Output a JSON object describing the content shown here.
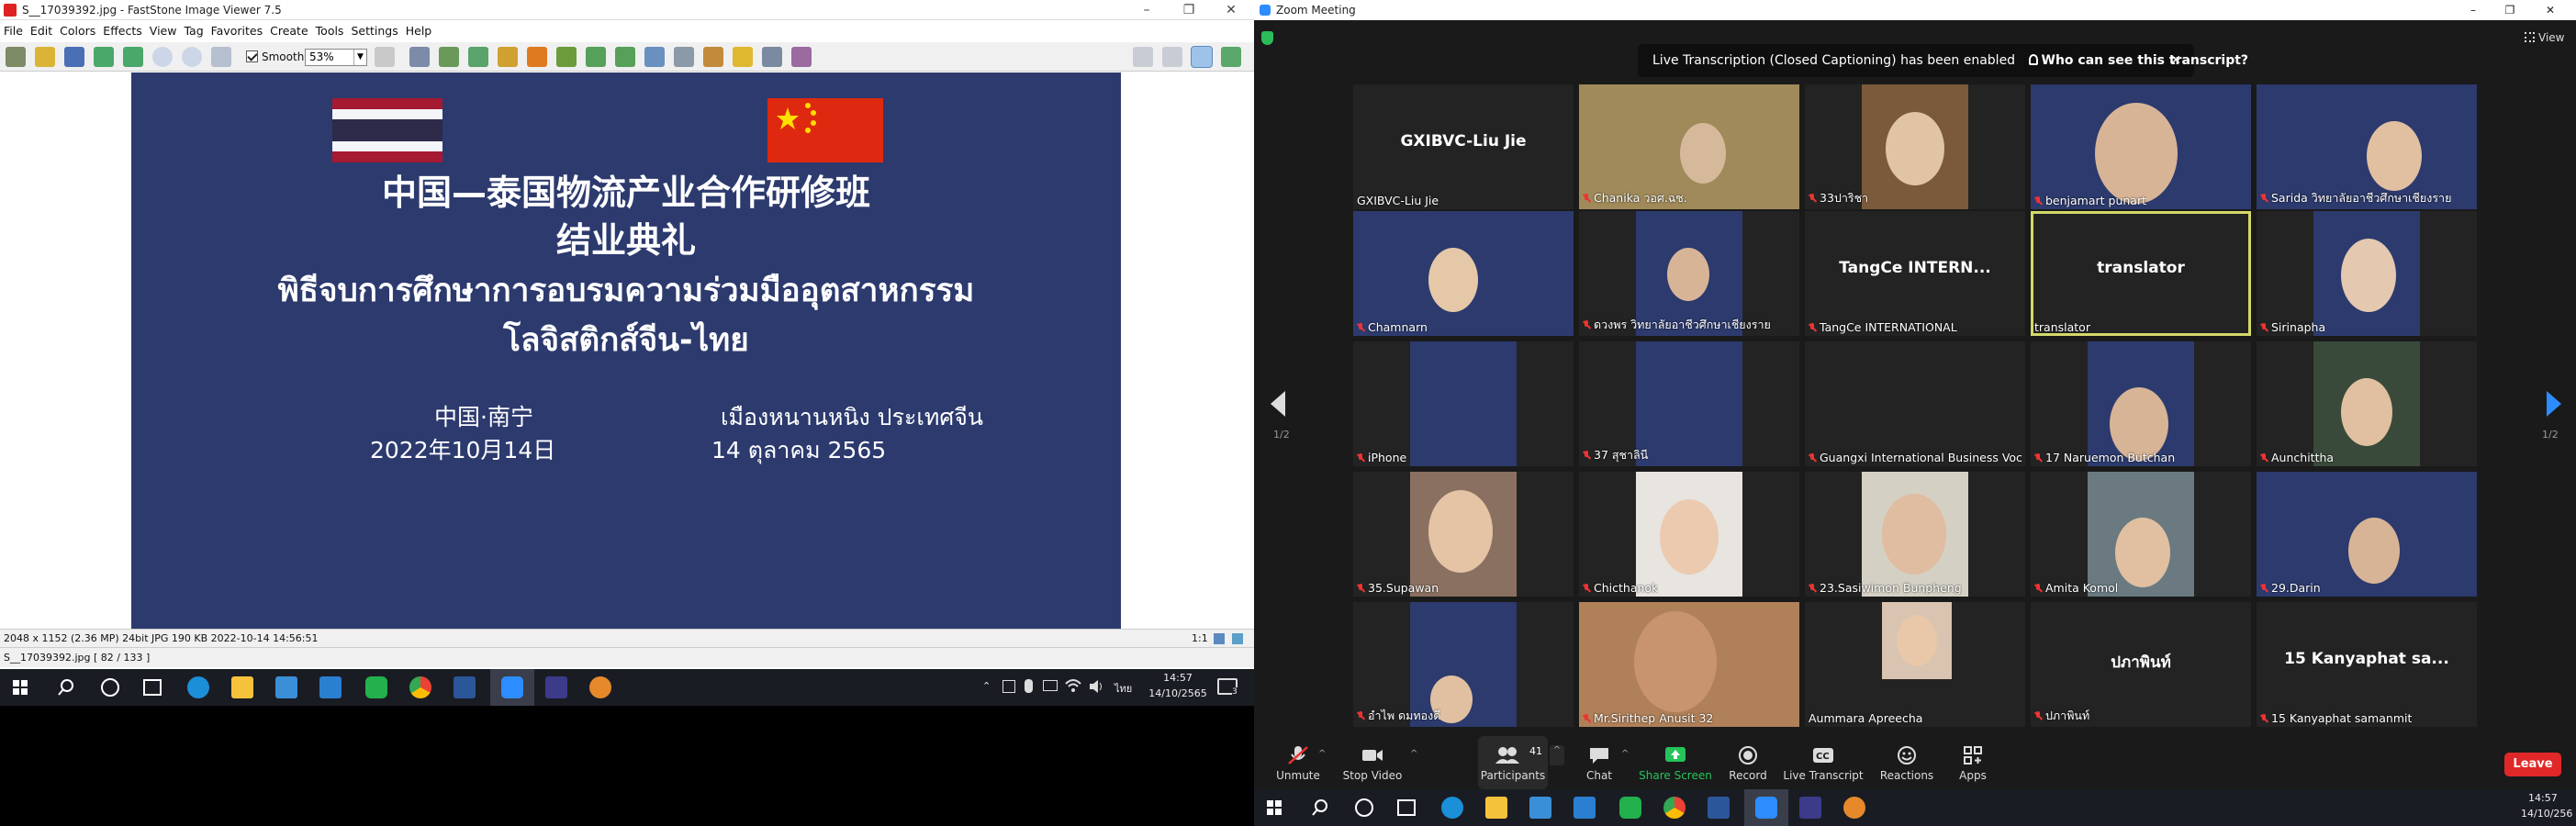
{
  "faststone": {
    "window_title": "S__17039392.jpg - FastStone Image Viewer 7.5",
    "menu": [
      "File",
      "Edit",
      "Colors",
      "Effects",
      "View",
      "Tag",
      "Favorites",
      "Create",
      "Tools",
      "Settings",
      "Help"
    ],
    "smooth_label": "Smooth",
    "zoom_value": "53%",
    "slide": {
      "title_cn_1": "中国—泰国物流产业合作研修班",
      "title_cn_2": "结业典礼",
      "title_th_1": "พิธีจบการศึกษาการอบรมความร่วมมืออุตสาหกรรม",
      "title_th_2": "โลจิสติกส์จีน-ไทย",
      "place_cn": "中国·南宁",
      "date_cn": "2022年10月14日",
      "place_th": "เมืองหนานหนิง ประเทศจีน",
      "date_th": "14 ตุลาคม 2565"
    },
    "status": "2048 x 1152 (2.36 MP)  24bit  JPG  190 KB  2022-10-14 14:56:51",
    "status_ratio": "1:1",
    "file_status": "S__17039392.jpg [ 82 / 133 ]"
  },
  "taskbar_left": {
    "lang": "ไทย",
    "time": "14:57",
    "date": "14/10/2565",
    "notif": "3"
  },
  "zoom": {
    "window_title": "Zoom Meeting",
    "view_label": "View",
    "banner_text": "Live Transcription (Closed Captioning) has been enabled",
    "banner_link": "Who can see this transcript?",
    "page_left": "1/2",
    "page_right": "1/2",
    "tiles": [
      {
        "name": "GXIBVC-Liu Jie",
        "big": "GXIBVC-Liu Jie"
      },
      {
        "name": "Chanika วอศ.ฉช."
      },
      {
        "name": "33ปาริชา"
      },
      {
        "name": "benjamart punart"
      },
      {
        "name": "Sarida วิทยาลัยอาชีวศึกษาเชียงราย"
      },
      {
        "name": "Chamnarn"
      },
      {
        "name": "ดวงพร วิทยาลัยอาชีวศึกษาเชียงราย"
      },
      {
        "name": "TangCe INTERNATIONAL",
        "big": "TangCe INTERN..."
      },
      {
        "name": "translator",
        "big": "translator"
      },
      {
        "name": "Sirinapha"
      },
      {
        "name": "iPhone"
      },
      {
        "name": "37 สุชาลินี"
      },
      {
        "name": "Guangxi International Business Voc..."
      },
      {
        "name": "17 Naruemon Butchan"
      },
      {
        "name": "Aunchittha"
      },
      {
        "name": "35.Supawan"
      },
      {
        "name": "Chicthanok"
      },
      {
        "name": "23.Sasiwimon Bunpheng"
      },
      {
        "name": "Amita Komol"
      },
      {
        "name": "29.Darin"
      },
      {
        "name": "อำไพ ดมทองดี"
      },
      {
        "name": "Mr.Sirithep Anusit 32"
      },
      {
        "name": "Aummara Apreecha"
      },
      {
        "name": "ปภาพินท์",
        "big": "ปภาพินท์"
      },
      {
        "name": "15 Kanyaphat samanmit",
        "big": "15 Kanyaphat sa..."
      }
    ],
    "controls": {
      "unmute": "Unmute",
      "stop_video": "Stop Video",
      "participants": "Participants",
      "participants_count": "41",
      "chat": "Chat",
      "share_screen": "Share Screen",
      "record": "Record",
      "live_transcript": "Live Transcript",
      "reactions": "Reactions",
      "apps": "Apps",
      "leave": "Leave"
    },
    "colors": {
      "share_green": "#25c35a",
      "leave_red": "#e02828",
      "highlight": "#d3d96a"
    }
  },
  "taskbar_right": {
    "time": "14:57",
    "date": "14/10/256"
  }
}
